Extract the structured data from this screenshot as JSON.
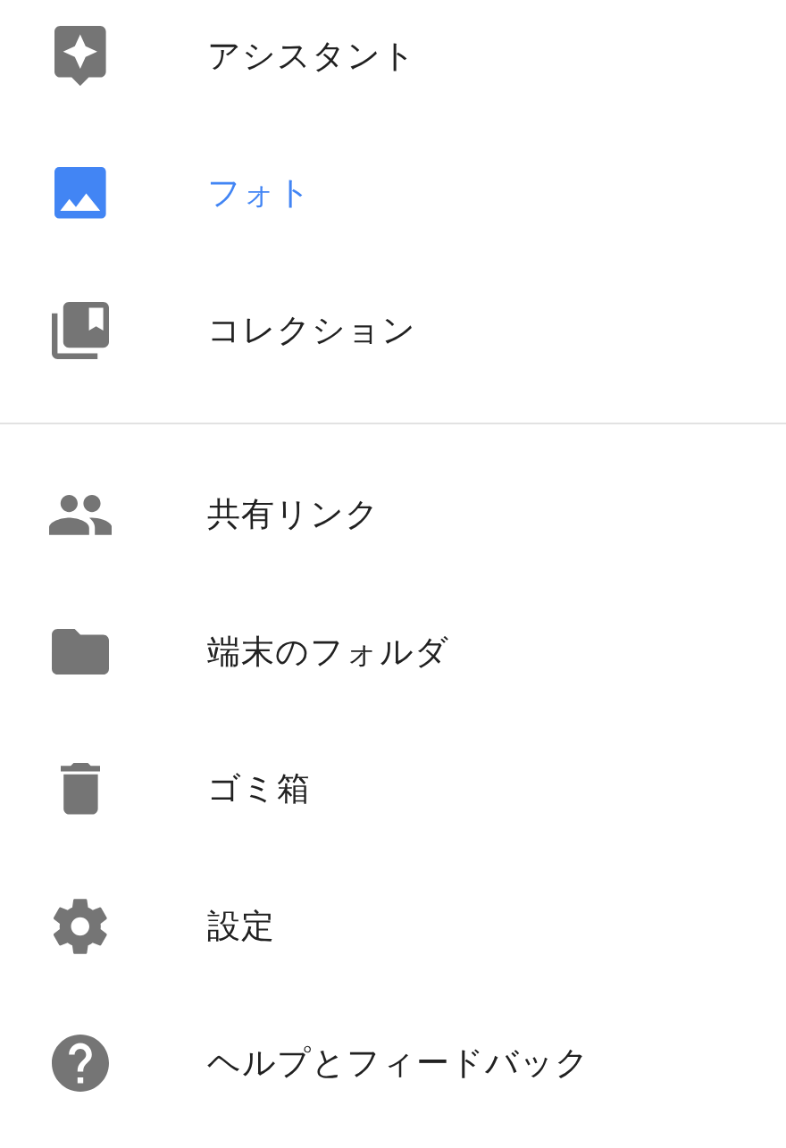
{
  "menu": {
    "sections": [
      {
        "items": [
          {
            "kind": "assistant",
            "label": "アシスタント",
            "selected": false
          },
          {
            "kind": "photos",
            "label": "フォト",
            "selected": true
          },
          {
            "kind": "collections",
            "label": "コレクション",
            "selected": false
          }
        ]
      },
      {
        "items": [
          {
            "kind": "shared",
            "label": "共有リンク",
            "selected": false
          },
          {
            "kind": "device-folders",
            "label": "端末のフォルダ",
            "selected": false
          },
          {
            "kind": "trash",
            "label": "ゴミ箱",
            "selected": false
          },
          {
            "kind": "settings",
            "label": "設定",
            "selected": false
          },
          {
            "kind": "help",
            "label": "ヘルプとフィードバック",
            "selected": false
          }
        ]
      }
    ]
  }
}
